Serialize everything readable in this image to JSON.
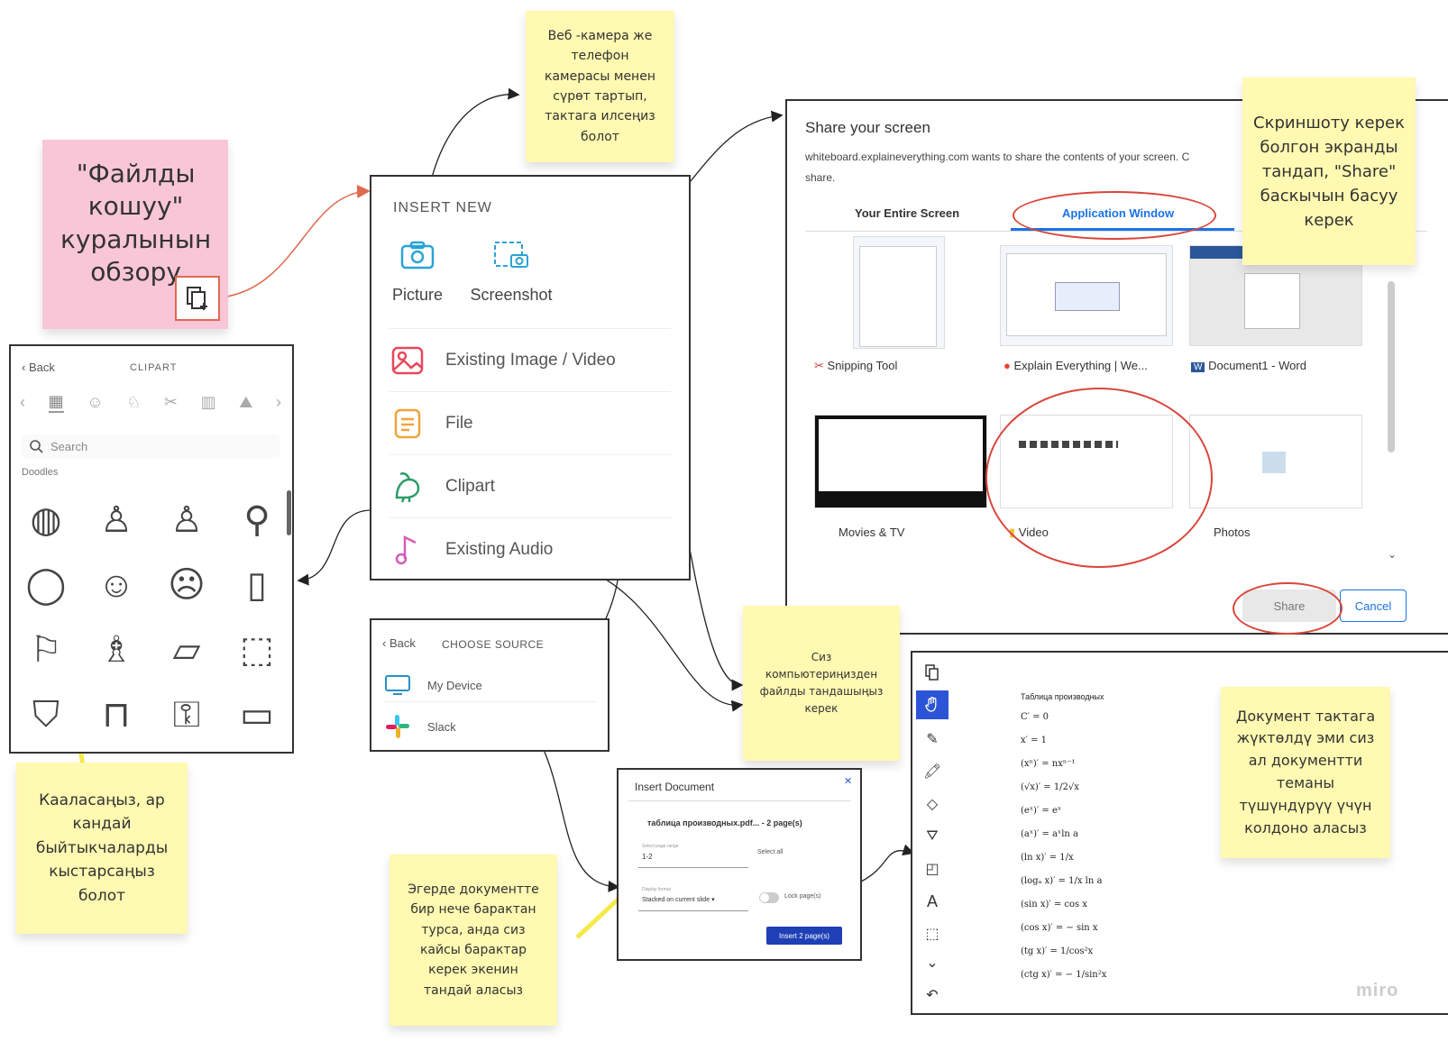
{
  "title_note": {
    "text": "\"Файлды\nкошуу\"\nкуралынын\nобзору"
  },
  "webcam_note": {
    "text": "Веб -камера же\nтелефон\nкамерасы менен\nсүрөт тартып,\nтактага илсеңиз\nболот"
  },
  "share_note": {
    "text": "Скриншоту керек\nболгон экранды\nтандап, \"Share\"\nбаскычын басуу\nкерек"
  },
  "files_note": {
    "text": "Сиз\nкомпьютериңизден\nфайлды тандашыңыз\nкерек"
  },
  "clipart_note": {
    "text": "Кааласаңыз, ар\nкандай\nбыйтыкчаларды\nкыстарсаңыз\nболот"
  },
  "pages_note": {
    "text": "Эгерде документте\nбир нече барактан\nтурса, анда сиз\nкайсы барактар\nкерек экенин\nтандай аласыз"
  },
  "doc_note": {
    "text": "Документ тактага\nжүктөлдү эми сиз\nал документти\nтеманы\nтүшүндүрүү үчүн\nколдоно аласыз"
  },
  "insert_new": {
    "heading": "INSERT NEW",
    "picture": "Picture",
    "screenshot": "Screenshot",
    "rows": [
      "Existing Image / Video",
      "File",
      "Clipart",
      "Existing Audio"
    ]
  },
  "clipart": {
    "back": "Back",
    "title": "CLIPART",
    "search_placeholder": "Search",
    "section": "Doodles",
    "items": [
      "globe",
      "person",
      "person",
      "runner",
      "face",
      "smiley",
      "sad-face",
      "portrait",
      "easel",
      "friends",
      "table",
      "box",
      "shirt",
      "pants",
      "key",
      "phone"
    ]
  },
  "share": {
    "title": "Share your screen",
    "description": "whiteboard.explaineverything.com wants to share the contents of your screen. C",
    "description2": "share.",
    "tab_entire": "Your Entire Screen",
    "tab_app": "Application Window",
    "windows": [
      "Snipping Tool",
      "Explain Everything | We...",
      "Document1 - Word",
      "Movies & TV",
      "Video",
      "Photos"
    ],
    "share_btn": "Share",
    "cancel_btn": "Cancel",
    "accent": "#1a73e8",
    "highlight": "#d9463b"
  },
  "choose_source": {
    "back": "Back",
    "title": "CHOOSE SOURCE",
    "options": [
      "My Device",
      "Slack"
    ]
  },
  "insert_doc": {
    "title": "Insert Document",
    "filename": "таблица производных.pdf... - 2 page(s)",
    "range_label": "Select page range",
    "range_value": "1-2",
    "select_all": "Select all",
    "display_label": "Display format",
    "display_value": "Stacked on current slide",
    "lock_label": "Lock page(s)",
    "insert_btn": "Insert 2 page(s)"
  },
  "board": {
    "table_title": "Таблица производных",
    "formulas": [
      "C′ = 0",
      "x′ = 1",
      "(xⁿ)′ = nxⁿ⁻¹",
      "(√x)′ = 1/2√x",
      "(eˣ)′ = eˣ",
      "(aˣ)′ = aˣln a",
      "(ln x)′ = 1/x",
      "(logₐ x)′ = 1/x ln a",
      "(sin x)′ = cos x",
      "(cos x)′ = − sin x",
      "(tg x)′ = 1/cos²x",
      "(ctg x)′ = − 1/sin²x"
    ],
    "watermark": "miro"
  }
}
